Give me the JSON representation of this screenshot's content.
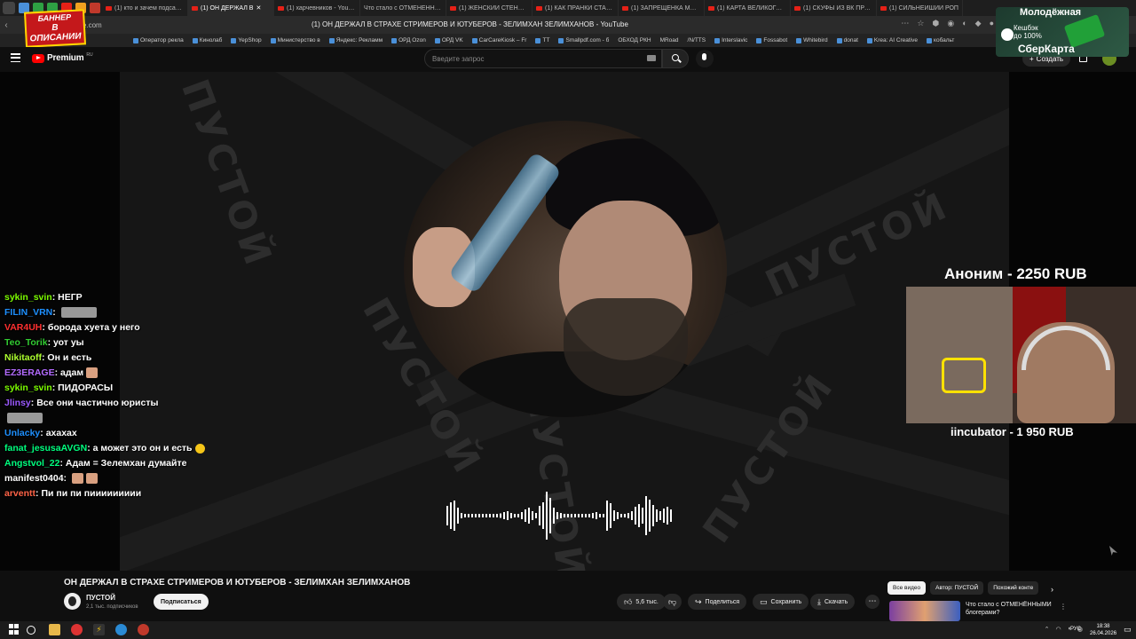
{
  "browser": {
    "tabs": [
      {
        "label": "(1) кто и зачем подсадил"
      },
      {
        "label": "(1) ОН ДЕРЖАЛ В",
        "active": true
      },
      {
        "label": "(1) харчевников - YouTube"
      },
      {
        "label": "Что стало с ОТМЕНЁННЫМИ"
      },
      {
        "label": "(1) ЖЕНСКИЙ СТЕНДАП"
      },
      {
        "label": "(1) КАК ПРАНКИ СТАЛИ"
      },
      {
        "label": "(1) ЗАПРЕЩЁНКА МЕСС"
      },
      {
        "label": "(1) КАРТА ВЕЛИКОГО П"
      },
      {
        "label": "(1) СКУФЫ ИЗ ВК ПРОБ"
      },
      {
        "label": "(1) СИЛЬНЕЙШИЙ РОП"
      }
    ],
    "url": "ube.com",
    "page_title": "(1) ОН ДЕРЖАЛ В СТРАХЕ СТРИМЕРОВ И ЮТУБЕРОВ - ЗЕЛИМХАН ЗЕЛИМХАНОВ - YouTube",
    "bookmarks": [
      "Оператор рекла",
      "Кинолаб",
      "YepShop",
      "Министерство в",
      "Яндекс: Рекламм",
      "ОРД Ozon",
      "ОРД VK",
      "CarCareKiosk – Fr",
      "TT",
      "Smallpdf.com - б",
      "ОБХОД РКН",
      "MRoad",
      "/N/TTS",
      "Interslavic",
      "Fossabot",
      "Whitebird",
      "donat",
      "Krea: AI Creative",
      "кобальт"
    ]
  },
  "overlay_banner": {
    "line1": "БАННЕР",
    "line2": "В ОПИСАНИИ"
  },
  "ad": {
    "line1": "Молодёжная",
    "line2": "Кешбэк",
    "line3": "до 100%",
    "line4": "СберКарта"
  },
  "youtube": {
    "logo_text": "Premium",
    "logo_region": "RU",
    "search_placeholder": "Введите запрос",
    "create_label": "Создать"
  },
  "video": {
    "bg_word": "ПУСТОЙ",
    "chat": [
      {
        "user": "sykin_svin",
        "color": "#7cfc00",
        "text": "НЕГР",
        "emote": null
      },
      {
        "user": "FILIN_VRN",
        "color": "#1e90ff",
        "text": "",
        "emote": "wide"
      },
      {
        "user": "VAR4UH",
        "color": "#ff3030",
        "text": "борода хуета у него",
        "emote": null
      },
      {
        "user": "Teo_Torik",
        "color": "#32cd32",
        "text": "уот уы",
        "emote": null
      },
      {
        "user": "Nikitaoff",
        "color": "#adff2f",
        "text": "Он и есть",
        "emote": null
      },
      {
        "user": "EZ3ERAGE",
        "color": "#b36bff",
        "text": "адам",
        "emote": "face"
      },
      {
        "user": "sykin_svin",
        "color": "#7cfc00",
        "text": "ПИДОРАСЫ",
        "emote": null
      },
      {
        "user": "Jlinsy",
        "color": "#9b59ff",
        "text": "Все они частично юристы",
        "emote": null
      },
      {
        "user": "",
        "color": "#ffffff",
        "text": "",
        "emote": "wide"
      },
      {
        "user": "Unlacky",
        "color": "#1e90ff",
        "text": "ахахах",
        "emote": null
      },
      {
        "user": "fanat_jesusaAVGN",
        "color": "#00ff7f",
        "text": "а может это он и есть",
        "emote": "round"
      },
      {
        "user": "Angstvol_22",
        "color": "#00ff7f",
        "text": "Адам = Зелемхан думайте",
        "emote": null
      },
      {
        "user": "manifest0404",
        "color": "#ffffff",
        "text": "",
        "emote": "faces"
      },
      {
        "user": "arventt",
        "color": "#ff6347",
        "text": "Пи пи пи пиииииииии",
        "emote": null
      }
    ],
    "donation": {
      "title": "Аноним - 2250 RUB",
      "subtitle": "iincubator - 1 950 RUB"
    }
  },
  "details": {
    "title": "ОН ДЕРЖАЛ В СТРАХЕ СТРИМЕРОВ И ЮТУБЕРОВ - ЗЕЛИМХАН ЗЕЛИМХАНОВ",
    "channel": "ПУСТОЙ",
    "subscribers": "2,1 тыс. подписчиков",
    "subscribe_label": "Подписаться",
    "likes": "5,6 тыс.",
    "share_label": "Поделиться",
    "save_label": "Сохранить",
    "download_label": "Скачать",
    "chips": [
      "Все видео",
      "Автор: ПУСТОЙ",
      "Похожий конте"
    ],
    "rec_title": "Что стало с ОТМЕНЁННЫМИ блогерами?"
  },
  "taskbar": {
    "lang": "РУС",
    "time": "18:38",
    "date": "26.04.2026"
  }
}
